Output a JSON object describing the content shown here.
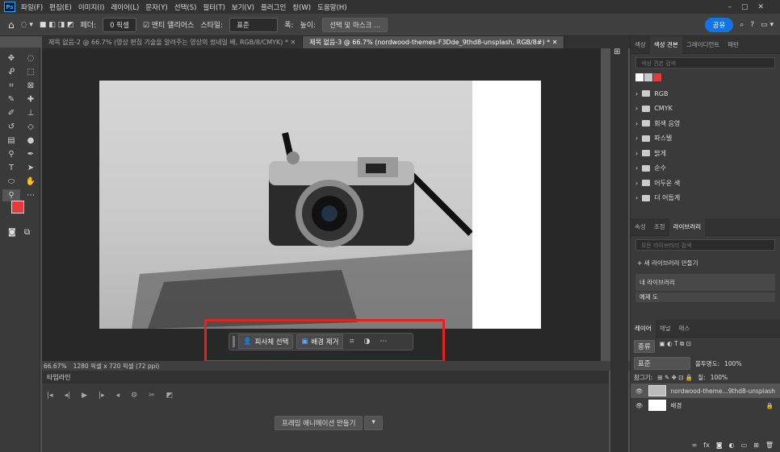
{
  "menu": [
    "파일(F)",
    "편집(E)",
    "이미지(I)",
    "레이어(L)",
    "문자(Y)",
    "선택(S)",
    "필터(T)",
    "보기(V)",
    "플러그인",
    "창(W)",
    "도움말(H)"
  ],
  "options": {
    "feather_label": "페더:",
    "feather_value": "0 픽셀",
    "antialias": "앤티 앨리어스",
    "style_label": "스타일:",
    "style_value": "표준",
    "width_label": "폭:",
    "height_label": "높이:",
    "select_mask": "선택 및 마스크 ...",
    "share": "공유"
  },
  "tabs": [
    "제목 없음-2 @ 66.7% (영상 편집 기술을 알려주는 영상의 썸네일 배, RGB/8/CMYK) *",
    "제목 없음-3 @ 66.7% (nordwood-themes-F3Dde_9thd8-unsplash, RGB/8#) *"
  ],
  "context_bar": {
    "select_subject": "피사체 선택",
    "remove_bg": "배경 제거"
  },
  "status": {
    "zoom": "66.67%",
    "size": "1280 픽셀 x 720 픽셀 (72 ppi)"
  },
  "timeline": {
    "title": "타임라인",
    "create_button": "프레임 애니메이션 만들기"
  },
  "swatch_panel": {
    "tabs": [
      "색상",
      "색상 견본",
      "그레이디언트",
      "패턴"
    ],
    "search_placeholder": "색상 견본 검색",
    "swatch_colors": [
      "#ffffff",
      "#c8c8c8",
      "#e5393a"
    ],
    "folders": [
      "RGB",
      "CMYK",
      "회색 음영",
      "파스텔",
      "밝게",
      "순수",
      "어두운 색",
      "더 어둡게"
    ]
  },
  "library_panel": {
    "tabs": [
      "속성",
      "조정",
      "라이브러리"
    ],
    "search_placeholder": "모든 라이브러리 검색",
    "new_library": "새 라이브러리 만들기",
    "my_library": "내 라이브러리",
    "cut_item": "예제 도"
  },
  "layers_panel": {
    "tabs": [
      "레이어",
      "채널",
      "패스"
    ],
    "kind": "종류",
    "blend": "표준",
    "opacity_label": "불투명도:",
    "opacity": "100%",
    "lock_label": "잠그기:",
    "fill_label": "칠:",
    "fill": "100%",
    "layers": [
      "nordwood-theme...9thd8-unsplash",
      "배경"
    ]
  },
  "colors": {
    "foreground": "#e5393a",
    "background": "#ffffff",
    "highlight": "#e8211f",
    "accent": "#1473e6"
  }
}
